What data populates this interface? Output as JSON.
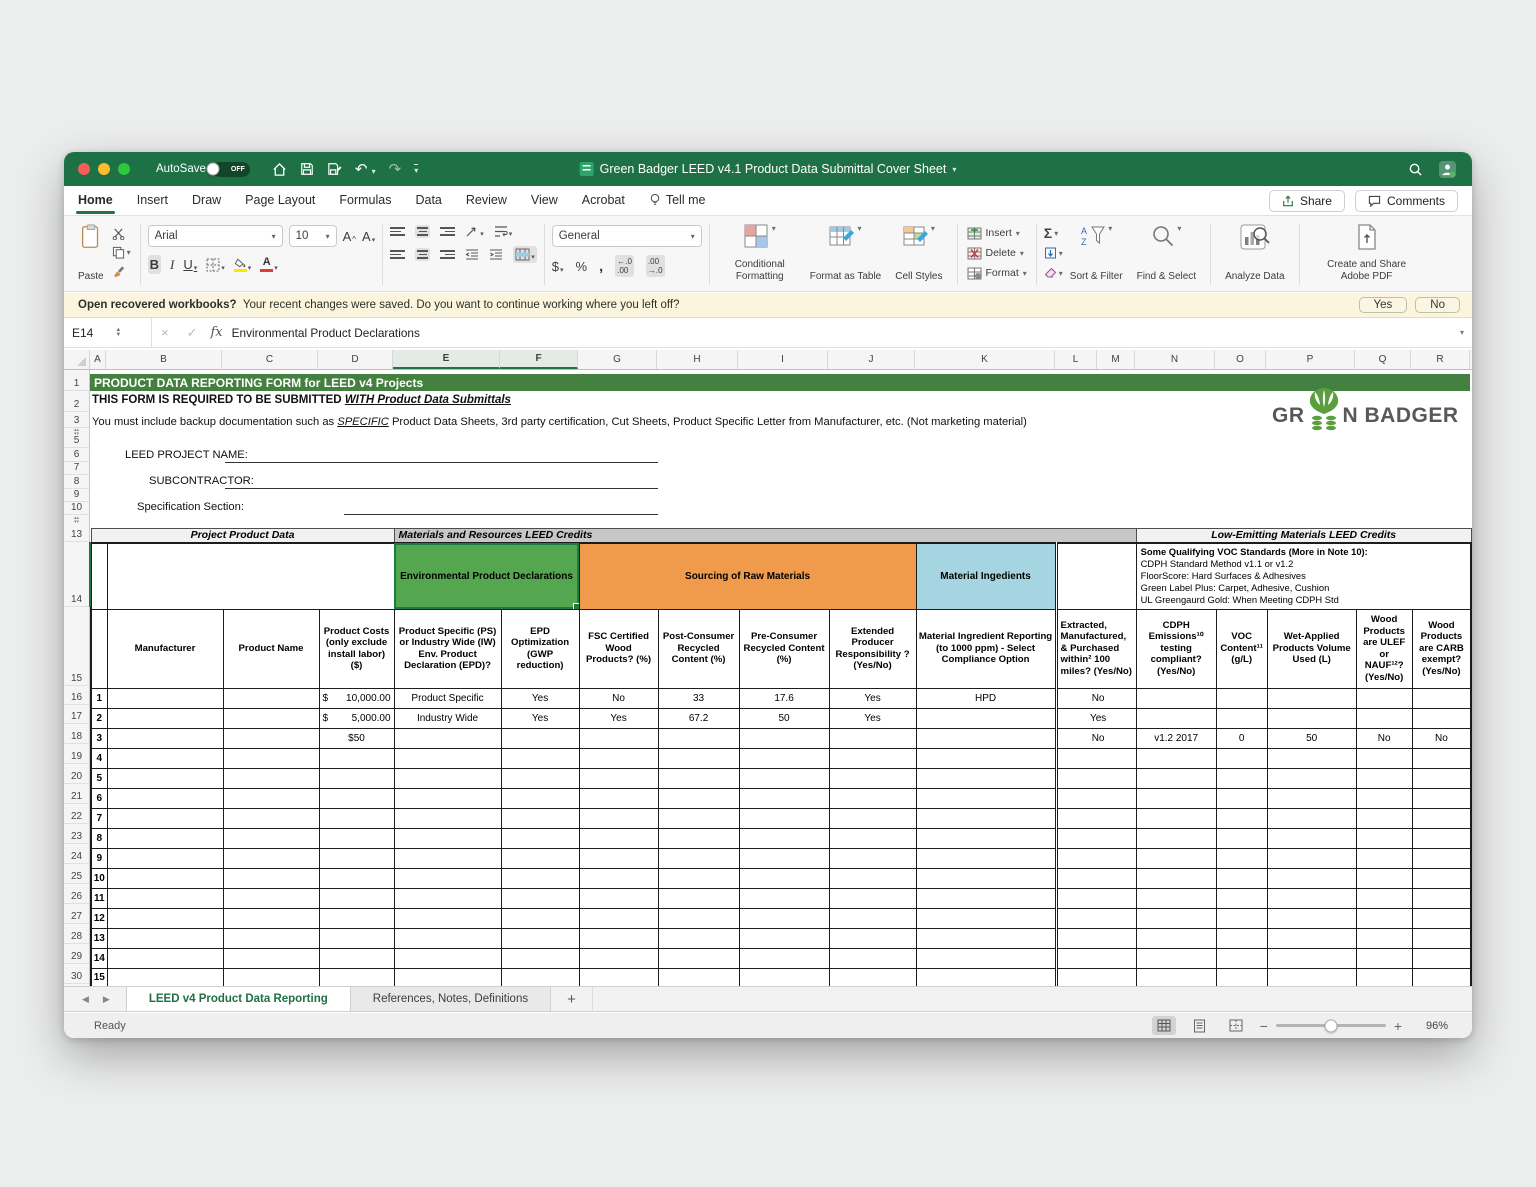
{
  "window": {
    "autosave": "AutoSave",
    "autosave_state": "OFF",
    "title": "Green Badger LEED v4.1 Product Data Submittal Cover Sheet"
  },
  "menu": {
    "tabs": [
      "Home",
      "Insert",
      "Draw",
      "Page Layout",
      "Formulas",
      "Data",
      "Review",
      "View",
      "Acrobat",
      "Tell me"
    ],
    "share": "Share",
    "comments": "Comments"
  },
  "ribbon": {
    "paste": "Paste",
    "font_name": "Arial",
    "font_size": "10",
    "number_format": "General",
    "conditional_formatting": "Conditional Formatting",
    "format_as_table": "Format as Table",
    "cell_styles": "Cell Styles",
    "insert": "Insert",
    "delete": "Delete",
    "format": "Format",
    "sort_filter": "Sort & Filter",
    "find_select": "Find & Select",
    "analyze_data": "Analyze Data",
    "adobe_pdf": "Create and Share Adobe PDF"
  },
  "notice": {
    "prompt": "Open recovered workbooks?",
    "body": "Your recent changes were saved. Do you want to continue working where you left off?",
    "yes": "Yes",
    "no": "No"
  },
  "formula_bar": {
    "cell_ref": "E14",
    "value": "Environmental Product Declarations"
  },
  "sheet": {
    "columns": [
      "A",
      "B",
      "C",
      "D",
      "E",
      "F",
      "G",
      "H",
      "I",
      "J",
      "K",
      "L",
      "M",
      "N",
      "O",
      "P",
      "Q",
      "R"
    ],
    "selected_columns": [
      "E",
      "F"
    ],
    "row_numbers": [
      "1",
      "2",
      "3",
      "5",
      "6",
      "7",
      "8",
      "9",
      "10",
      "13",
      "14",
      "15",
      "16",
      "17",
      "18",
      "19",
      "20",
      "21",
      "22",
      "23",
      "24",
      "25",
      "26",
      "27",
      "28",
      "29",
      "30"
    ]
  },
  "form": {
    "banner": "PRODUCT DATA REPORTING FORM for LEED v4 Projects",
    "required_prefix": "THIS FORM IS REQUIRED TO BE SUBMITTED ",
    "required_emphasis": "WITH Product Data Submittals",
    "backup_pre": "You must include backup documentation such as ",
    "backup_specific": "SPECIFIC",
    "backup_post": " Product Data Sheets, 3rd party certification, Cut Sheets, Product Specific Letter from Manufacturer, etc. (Not marketing material)",
    "label_project": "LEED PROJECT NAME:",
    "label_subcontractor": "SUBCONTRACTOR:",
    "label_spec": "Specification Section:",
    "logo_left": "GR",
    "logo_right": "N BADGER"
  },
  "table": {
    "groups": {
      "left": "Project Product Data",
      "mid": "Materials and Resources LEED Credits",
      "right": "Low-Emitting Materials LEED Credits"
    },
    "sections": {
      "epd": "Environmental Product Declarations",
      "sourcing": "Sourcing of Raw Materials",
      "ingredients": "Material Ingedients"
    },
    "voc_note": {
      "title": "Some Qualifying VOC Standards (More in Note 10):",
      "lines": [
        "CDPH Standard Method v1.1 or v1.2",
        "FloorScore: Hard Surfaces & Adhesives",
        "Green Label Plus: Carpet, Adhesive, Cushion",
        "UL Greengaurd Gold: When Meeting CDPH Std"
      ]
    },
    "headers": [
      "Manufacturer",
      "Product Name",
      "Product Costs (only exclude install labor) ($)",
      "Product Specific (PS) or Industry Wide (IW) Env. Product Declaration (EPD)?",
      "EPD Optimization (GWP reduction)",
      "FSC Certified Wood Products? (%)",
      "Post-Consumer Recycled Content (%)",
      "Pre-Consumer Recycled Content (%)",
      "Extended Producer Responsibility ? (Yes/No)",
      "Material Ingredient Reporting (to 1000 ppm) - Select Compliance Option",
      "Extracted, Manufactured, & Purchased within² 100 miles? (Yes/No)",
      "CDPH Emissions¹⁰ testing compliant? (Yes/No)",
      "VOC Content¹¹ (g/L)",
      "Wet-Applied Products Volume Used (L)",
      "Wood Products are ULEF or NAUF¹²? (Yes/No)",
      "Wood Products are CARB exempt? (Yes/No)"
    ],
    "rows": [
      {
        "n": "1",
        "cells": [
          "",
          "",
          "$|10,000.00",
          "Product Specific",
          "Yes",
          "No",
          "33",
          "17.6",
          "Yes",
          "HPD",
          "No",
          "",
          "",
          "",
          "",
          ""
        ]
      },
      {
        "n": "2",
        "cells": [
          "",
          "",
          "$|5,000.00",
          "Industry Wide",
          "Yes",
          "Yes",
          "67.2",
          "50",
          "Yes",
          "",
          "Yes",
          "",
          "",
          "",
          "",
          ""
        ]
      },
      {
        "n": "3",
        "cells": [
          "",
          "",
          "$50",
          "",
          "",
          "",
          "",
          "",
          "",
          "",
          "No",
          "v1.2 2017",
          "0",
          "50",
          "No",
          "No"
        ]
      },
      {
        "n": "4",
        "cells": []
      },
      {
        "n": "5",
        "cells": []
      },
      {
        "n": "6",
        "cells": []
      },
      {
        "n": "7",
        "cells": []
      },
      {
        "n": "8",
        "cells": []
      },
      {
        "n": "9",
        "cells": []
      },
      {
        "n": "10",
        "cells": []
      },
      {
        "n": "11",
        "cells": []
      },
      {
        "n": "12",
        "cells": []
      },
      {
        "n": "13",
        "cells": []
      },
      {
        "n": "14",
        "cells": []
      },
      {
        "n": "15",
        "cells": []
      }
    ]
  },
  "sheet_tabs": {
    "active": "LEED v4 Product Data Reporting",
    "inactive": "References, Notes, Definitions",
    "add": "+"
  },
  "status": {
    "ready": "Ready",
    "zoom": "96%"
  }
}
